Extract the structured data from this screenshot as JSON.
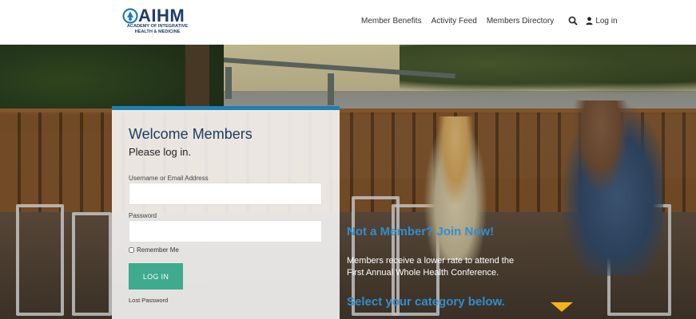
{
  "header": {
    "logo": {
      "name": "AIHM",
      "subtitle_line1": "ACADEMY OF INTEGRATIVE",
      "subtitle_line2": "HEALTH & MEDICINE",
      "color": "#1d3b6b"
    },
    "nav": [
      {
        "label": "Member Benefits"
      },
      {
        "label": "Activity Feed"
      },
      {
        "label": "Members Directory"
      }
    ],
    "search_icon": "search-icon",
    "login_label": "Log in"
  },
  "login_panel": {
    "title": "Welcome Members",
    "subtitle": "Please log in.",
    "username_label": "Username or Email Address",
    "username_value": "",
    "password_label": "Password",
    "password_value": "",
    "remember_label": "Remember Me",
    "remember_checked": false,
    "login_button": "LOG IN",
    "lost_password": "Lost Password",
    "accent_color": "#1f7fb0",
    "button_color": "#3eaa8e"
  },
  "promo": {
    "join_title": "Not a Member? Join Now!",
    "description_line1": "Members receive a lower rate to attend the",
    "description_line2": "First Annual Whole Health Conference.",
    "select_category": "Select your category below.",
    "heading_color": "#2f8ecf",
    "arrow_color": "#f2b31b"
  }
}
